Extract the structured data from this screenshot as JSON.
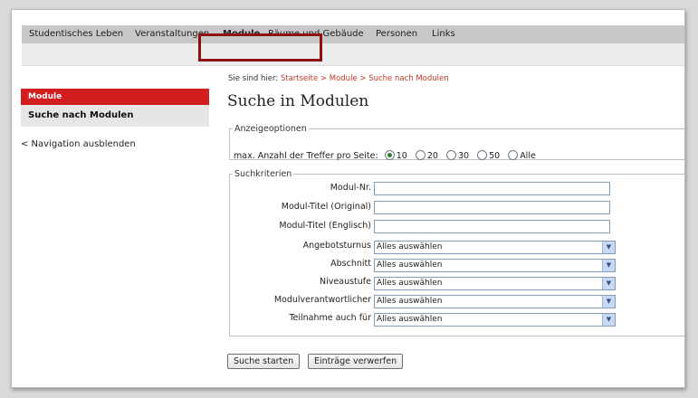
{
  "topnav": {
    "items": [
      {
        "label": "Studentisches Leben"
      },
      {
        "label": "Veranstaltungen"
      },
      {
        "label": "Module"
      },
      {
        "label": "Räume und Gebäude"
      },
      {
        "label": "Personen"
      },
      {
        "label": "Links"
      }
    ]
  },
  "sidebar": {
    "header": "Module",
    "item": "Suche nach Modulen",
    "hide_nav": "< Navigation ausblenden"
  },
  "breadcrumb": {
    "prefix": "Sie sind hier:",
    "home": "Startseite",
    "sep1": ">",
    "level1": "Module",
    "sep2": ">",
    "level2": "Suche nach Modulen"
  },
  "page_title": "Suche in Modulen",
  "options": {
    "legend": "Anzeigeoptionen",
    "label": "max. Anzahl der Treffer pro Seite:",
    "choices": [
      "10",
      "20",
      "30",
      "50",
      "Alle"
    ],
    "selected": "10"
  },
  "criteria": {
    "legend": "Suchkriterien",
    "text_fields": [
      {
        "label": "Modul-Nr.",
        "value": ""
      },
      {
        "label": "Modul-Titel (Original)",
        "value": ""
      },
      {
        "label": "Modul-Titel (Englisch)",
        "value": ""
      }
    ],
    "selects": [
      {
        "label": "Angebotsturnus",
        "value": "Alles auswählen"
      },
      {
        "label": "Abschnitt",
        "value": "Alles auswählen"
      },
      {
        "label": "Niveaustufe",
        "value": "Alles auswählen"
      },
      {
        "label": "Modulverantwortlicher",
        "value": "Alles auswählen"
      },
      {
        "label": "Teilnahme auch für",
        "value": "Alles auswählen"
      }
    ]
  },
  "buttons": {
    "search": "Suche starten",
    "reset": "Einträge verwerfen"
  },
  "colors": {
    "accent_red": "#d21e1e",
    "highlight_box": "#8b1010",
    "link_red": "#c0392b"
  }
}
